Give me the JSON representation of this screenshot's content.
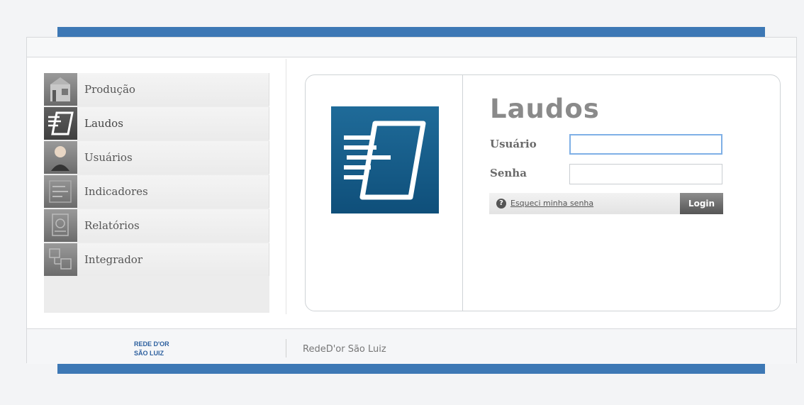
{
  "colors": {
    "accent": "#3d78b5",
    "logo_bg": "#1f6b99"
  },
  "menu": {
    "items": [
      {
        "label": "Produção",
        "icon": "factory-icon"
      },
      {
        "label": "Laudos",
        "icon": "laudos-logo-icon"
      },
      {
        "label": "Usuários",
        "icon": "user-icon"
      },
      {
        "label": "Indicadores",
        "icon": "chart-icon"
      },
      {
        "label": "Relatórios",
        "icon": "report-icon"
      },
      {
        "label": "Integrador",
        "icon": "integrator-icon"
      }
    ]
  },
  "login": {
    "title": "Laudos",
    "username_label": "Usuário",
    "username_value": "",
    "password_label": "Senha",
    "password_value": "",
    "help_glyph": "?",
    "forgot_link": "Esqueci minha senha",
    "submit_label": "Login"
  },
  "footer": {
    "logo_text_top": "REDE D'OR",
    "logo_text_bottom": "SÃO LUIZ",
    "text": "RedeD'or São Luiz"
  }
}
